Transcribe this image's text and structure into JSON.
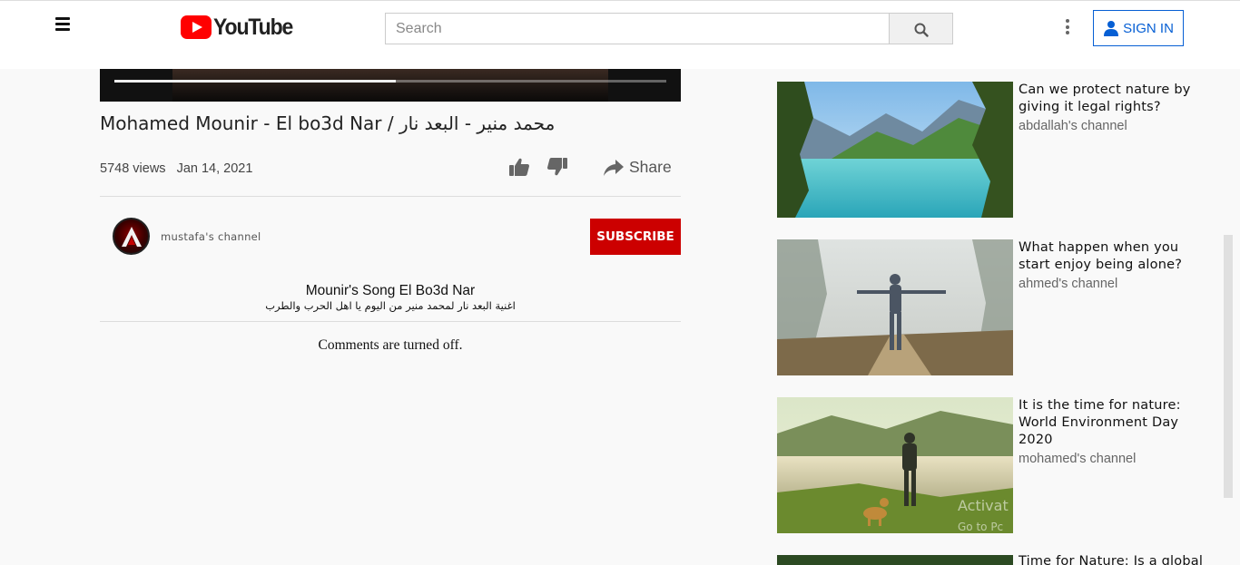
{
  "header": {
    "logo_text": "YouTube",
    "search_placeholder": "Search",
    "signin_label": "SIGN IN"
  },
  "player": {
    "progress": 0.51
  },
  "video": {
    "title": "Mohamed Mounir - El bo3d Nar / محمد منير - البعد نار",
    "views": "5748 views",
    "date": "Jan 14, 2021",
    "share_label": "Share"
  },
  "channel": {
    "name": "mustafa's channel",
    "subscribe_label": "SUBSCRIBE"
  },
  "description": {
    "title": "Mounir's Song El Bo3d Nar",
    "text": "اغنية البعد نار لمحمد منير من اليوم يا اهل الحرب والطرب"
  },
  "comments_status": "Comments are turned off.",
  "recommendations": [
    {
      "title": "Can we protect nature by giving it legal rights?",
      "channel": "abdallah's channel"
    },
    {
      "title": "What happen when you start enjoy being alone?",
      "channel": "ahmed's channel"
    },
    {
      "title": "It is the time for nature: World Environment Day 2020",
      "channel": "mohamed's channel"
    },
    {
      "title": "Time for Nature: Is a global",
      "channel": ""
    }
  ],
  "os_watermark": {
    "line1": "Activat",
    "line2": "Go to Pc"
  },
  "colors": {
    "accent": "#065fd4",
    "subscribe": "#cc0000",
    "brand": "#ff0000"
  }
}
